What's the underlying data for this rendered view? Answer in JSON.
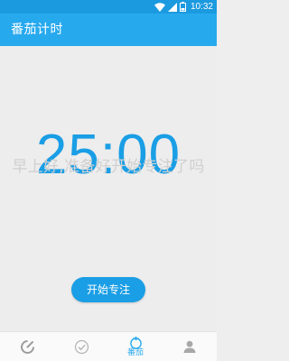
{
  "status_bar": {
    "time": "10:32",
    "battery_level": "8",
    "icons": [
      "wifi-icon",
      "cellular-signal-icon",
      "battery-icon"
    ]
  },
  "app_bar": {
    "title": "番茄计时"
  },
  "timer": {
    "display": "25:00",
    "greeting": "早上好,准备好开始专注了吗"
  },
  "actions": {
    "start_label": "开始专注"
  },
  "bottom_nav": {
    "items": [
      {
        "icon": "stats-chart-icon",
        "label": "",
        "active": false
      },
      {
        "icon": "checkmark-circle-icon",
        "label": "",
        "active": false
      },
      {
        "icon": "tomato-icon",
        "label": "番茄",
        "active": true
      },
      {
        "icon": "profile-person-icon",
        "label": "",
        "active": false
      }
    ]
  },
  "colors": {
    "status_bar": "#1c9ae0",
    "app_bar": "#27a9ee",
    "accent": "#1a9ee5",
    "background": "#ededed",
    "inactive_icon": "#a8a8a8"
  }
}
